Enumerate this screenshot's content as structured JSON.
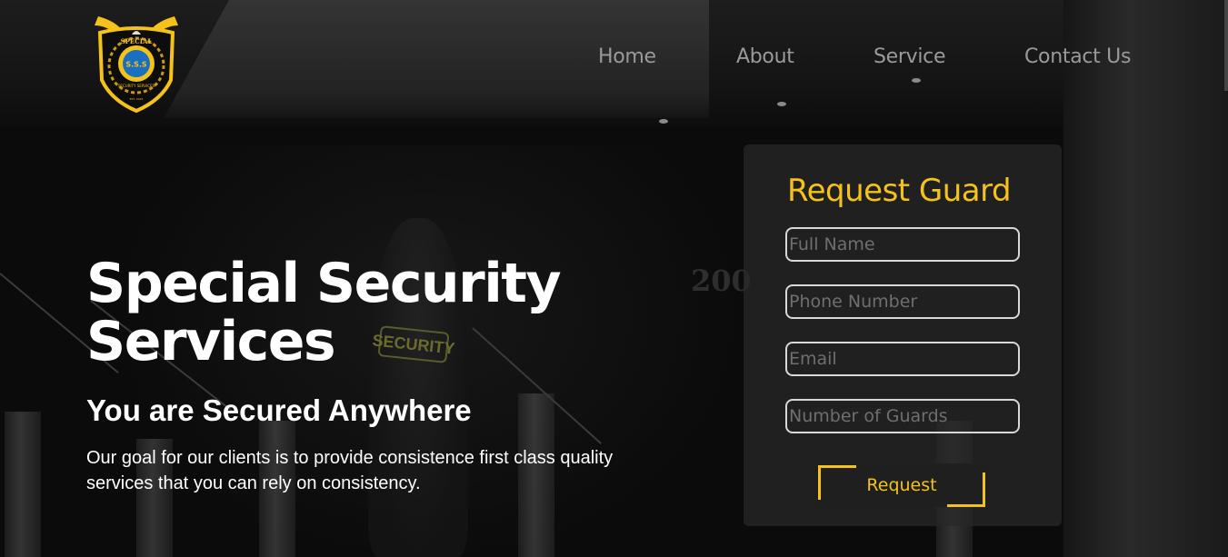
{
  "brand": {
    "logo_top_text": "SPECIAL",
    "logo_center_text": "S.S.S",
    "logo_ring_text": "SECURITY SERVICES",
    "logo_bottom_text": "EST. 2015",
    "gold": "#f5c21b",
    "blue": "#1a6fc0"
  },
  "nav": {
    "items": [
      "Home",
      "About",
      "Service",
      "Contact Us"
    ]
  },
  "hero": {
    "title": "Special Security Services",
    "subtitle": "You are Secured Anywhere",
    "description": "Our goal for our clients is to provide consistence first class quality services that you can rely on consistency."
  },
  "background": {
    "patch_text": "SECURITY",
    "sign_text": "200"
  },
  "form": {
    "title": "Request Guard",
    "fields": [
      {
        "placeholder": "Full Name",
        "value": ""
      },
      {
        "placeholder": "Phone Number",
        "value": ""
      },
      {
        "placeholder": "Email",
        "value": ""
      },
      {
        "placeholder": "Number of Guards",
        "value": ""
      }
    ],
    "submit_label": "Request"
  },
  "colors": {
    "accent": "#f5c21b",
    "nav_text": "#9a9a9a",
    "background": "#0b0b0b"
  }
}
